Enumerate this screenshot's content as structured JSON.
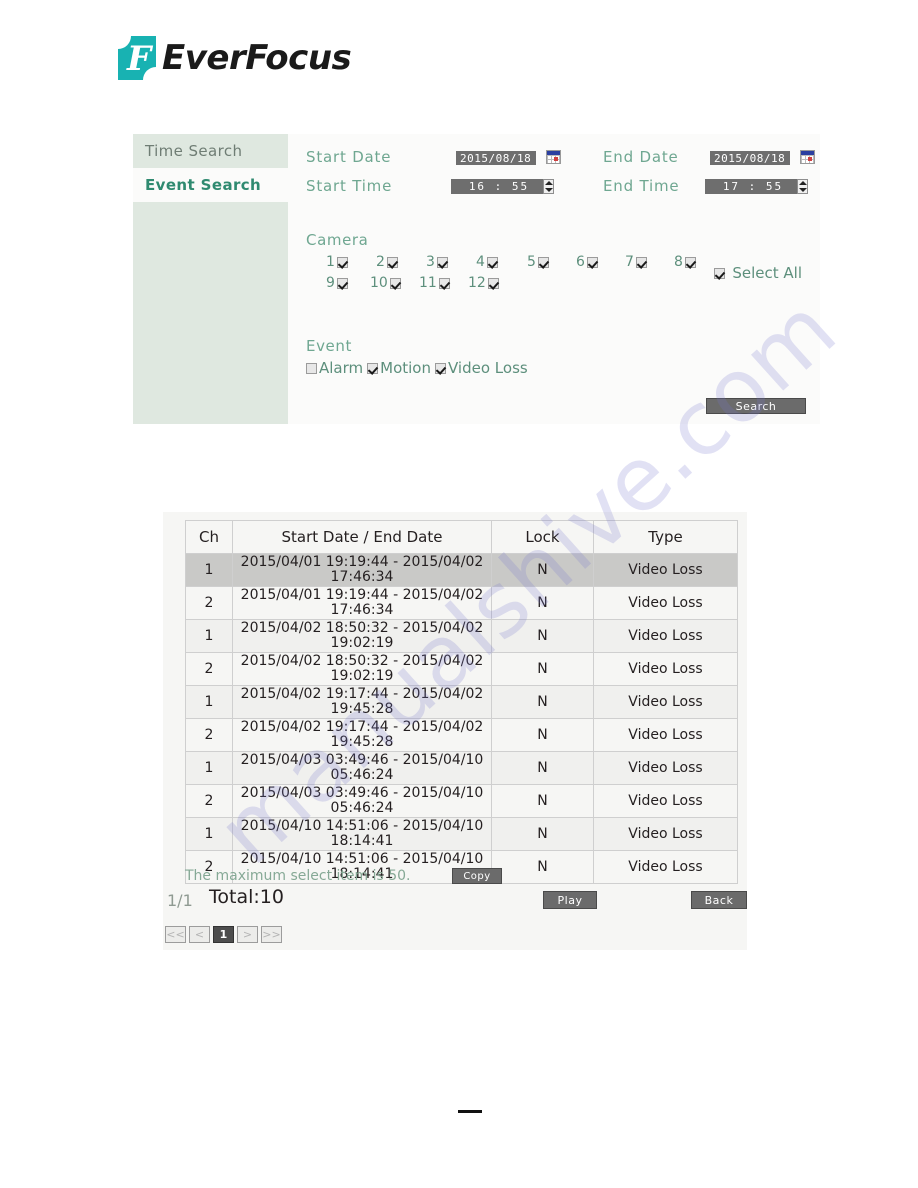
{
  "brand": {
    "name": "EverFocus",
    "logo_glyph": "F",
    "logo_color": "#18b2b2"
  },
  "watermark": {
    "text": "manualshive.com",
    "color": "#7878cd"
  },
  "search_panel": {
    "tabs": [
      {
        "label": "Time Search",
        "active": false
      },
      {
        "label": "Event Search",
        "active": true
      }
    ],
    "fields": {
      "start_date_label": "Start Date",
      "start_date_value": "2015/08/18",
      "end_date_label": "End Date",
      "end_date_value": "2015/08/18",
      "start_time_label": "Start Time",
      "start_time_value": "16 : 55",
      "end_time_label": "End Time",
      "end_time_value": "17 : 55"
    },
    "camera": {
      "title": "Camera",
      "items": [
        {
          "label": "1",
          "checked": true
        },
        {
          "label": "2",
          "checked": true
        },
        {
          "label": "3",
          "checked": true
        },
        {
          "label": "4",
          "checked": true
        },
        {
          "label": "5",
          "checked": true
        },
        {
          "label": "6",
          "checked": true
        },
        {
          "label": "7",
          "checked": true
        },
        {
          "label": "8",
          "checked": true
        },
        {
          "label": "9",
          "checked": true
        },
        {
          "label": "10",
          "checked": true
        },
        {
          "label": "11",
          "checked": true
        },
        {
          "label": "12",
          "checked": true
        }
      ],
      "select_all_label": "Select All",
      "select_all_checked": true
    },
    "event": {
      "title": "Event",
      "items": [
        {
          "label": "Alarm",
          "checked": false
        },
        {
          "label": "Motion",
          "checked": true
        },
        {
          "label": "Video Loss",
          "checked": true
        }
      ]
    },
    "search_button_label": "Search"
  },
  "results": {
    "columns": [
      "Ch",
      "Start Date / End Date",
      "Lock",
      "Type"
    ],
    "rows": [
      {
        "ch": "1",
        "range": "2015/04/01 19:19:44 - 2015/04/02 17:46:34",
        "lock": "N",
        "type": "Video Loss",
        "selected": true
      },
      {
        "ch": "2",
        "range": "2015/04/01 19:19:44 - 2015/04/02 17:46:34",
        "lock": "N",
        "type": "Video Loss",
        "selected": false
      },
      {
        "ch": "1",
        "range": "2015/04/02 18:50:32 - 2015/04/02 19:02:19",
        "lock": "N",
        "type": "Video Loss",
        "selected": false
      },
      {
        "ch": "2",
        "range": "2015/04/02 18:50:32 - 2015/04/02 19:02:19",
        "lock": "N",
        "type": "Video Loss",
        "selected": false
      },
      {
        "ch": "1",
        "range": "2015/04/02 19:17:44 - 2015/04/02 19:45:28",
        "lock": "N",
        "type": "Video Loss",
        "selected": false
      },
      {
        "ch": "2",
        "range": "2015/04/02 19:17:44 - 2015/04/02 19:45:28",
        "lock": "N",
        "type": "Video Loss",
        "selected": false
      },
      {
        "ch": "1",
        "range": "2015/04/03 03:49:46 - 2015/04/10 05:46:24",
        "lock": "N",
        "type": "Video Loss",
        "selected": false
      },
      {
        "ch": "2",
        "range": "2015/04/03 03:49:46 - 2015/04/10 05:46:24",
        "lock": "N",
        "type": "Video Loss",
        "selected": false
      },
      {
        "ch": "1",
        "range": "2015/04/10 14:51:06 - 2015/04/10 18:14:41",
        "lock": "N",
        "type": "Video Loss",
        "selected": false
      },
      {
        "ch": "2",
        "range": "2015/04/10 14:51:06 - 2015/04/10 18:14:41",
        "lock": "N",
        "type": "Video Loss",
        "selected": false
      }
    ],
    "max_select_note": "The maximum select item is 50.",
    "copy_button_label": "Copy",
    "page_indicator": "1/1",
    "total_label": "Total:10",
    "play_button_label": "Play",
    "back_button_label": "Back",
    "pager": [
      {
        "label": "<<",
        "current": false
      },
      {
        "label": "<",
        "current": false
      },
      {
        "label": "1",
        "current": true
      },
      {
        "label": ">",
        "current": false
      },
      {
        "label": ">>",
        "current": false
      }
    ]
  }
}
